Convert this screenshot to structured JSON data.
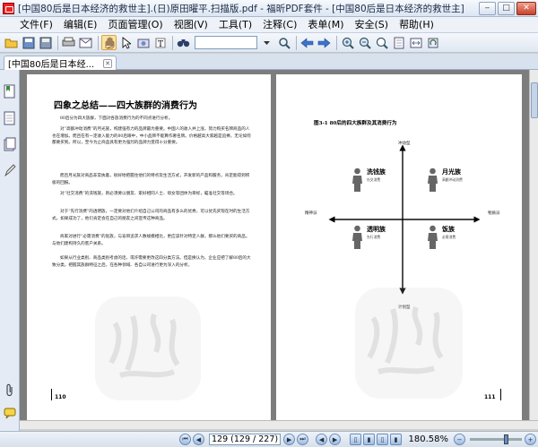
{
  "window": {
    "title": "[中国80后是日本经济的救世主].(日)原田曜平.扫描版.pdf - 福昕PDF套件 - [中国80后是日本经济的救世主]",
    "min": "‒",
    "max": "□",
    "close": "✕"
  },
  "menu": [
    "文件(F)",
    "编辑(E)",
    "页面管理(O)",
    "视图(V)",
    "工具(T)",
    "注释(C)",
    "表单(M)",
    "安全(S)",
    "帮助(H)"
  ],
  "tab": {
    "label": "[中国80后是日本经..."
  },
  "left_page": {
    "heading": "四象之总结——四大族群的消费行为",
    "paragraphs": [
      "80后分为四大族群，下面对各族消费行为的不同点进行分析。",
      "对“高额冲动消费”的月光族，构建强有力的品牌最为重要。中国人的收入并上涨，努力购买名牌商品的人也在增加。而且在有一定收入能力的80后眼中，中小品牌不能算作奢名牌。价格越高大家越是追捧，无论如何都要买到。所以，至今为止商品具有更为强烈的品牌力变得十分重要。",
      "而且月光族对商品非常执着，很好地把握住他们的特点及生活方式，开发新的产品和服务，肯定能得到积极的回报。",
      "对“社交消费”的洗钱族，则必须要以朋友、家好相同人士、母女等团体为目标，瞄准社交等场合。",
      "对于“先行消费”的透明族，一定要对他们介绍自己公司的商品有多么的优秀，可以优先买现在时的生活方式。如果成功了，他们肯定会在自己的朋友之间宣传这种商品。",
      "商家对进行“必需消费”的饭族，与盲目追求人数规模相比，更应该针对特定人群，那么他们要买的商品，与他们建构持久的客户关系。",
      "如果从行业类别、商品类别考虑的话，或许需要更改这四分类方法。但是换认为，企业应把了解80后的大致分类，把握其族群特征之后，在各种领域、各自公司进行更为深入的分析。"
    ],
    "page_number": "110"
  },
  "right_page": {
    "figure_title": "图3-1 80后的四大族群及其消费行为",
    "axis_top": "冲动型",
    "axis_bottom": "计划型",
    "axis_left": "精神派",
    "axis_right": "物质派",
    "quadrants": [
      {
        "name": "洗钱族",
        "sub": "社交消费"
      },
      {
        "name": "月光族",
        "sub": "高额冲动消费"
      },
      {
        "name": "透明族",
        "sub": "先行消费"
      },
      {
        "name": "饭族",
        "sub": "必需消费"
      }
    ],
    "page_number": "111"
  },
  "status": {
    "page_field": "129 (129 / 227)",
    "zoom": "180.58%"
  }
}
